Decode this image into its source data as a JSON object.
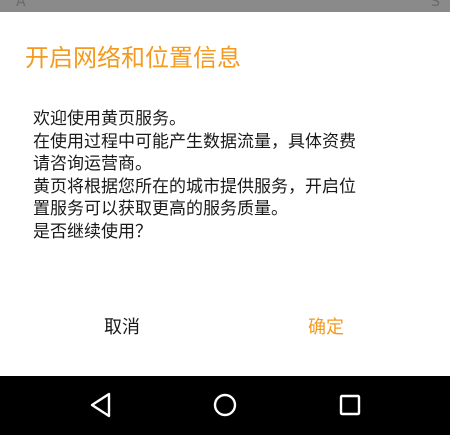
{
  "dialog": {
    "title": "开启网络和位置信息",
    "message_lines": [
      "欢迎使用黄页服务。",
      "在使用过程中可能产生数据流量，具体资费",
      "请咨询运营商。",
      "黄页将根据您所在的城市提供服务，开启位",
      "置服务可以获取更高的服务质量。",
      "是否继续使用？"
    ],
    "cancel_label": "取消",
    "confirm_label": "确定"
  },
  "background": {
    "left_glyph": "A",
    "right_glyph": "S"
  },
  "navbar": {
    "back_icon": "back-triangle-icon",
    "home_icon": "home-circle-icon",
    "recent_icon": "recent-apps-square-icon"
  },
  "colors": {
    "accent": "#f39a1f",
    "text": "#1a1a1a",
    "navbar": "#000000",
    "dim_overlay": "#8a8a8a"
  }
}
